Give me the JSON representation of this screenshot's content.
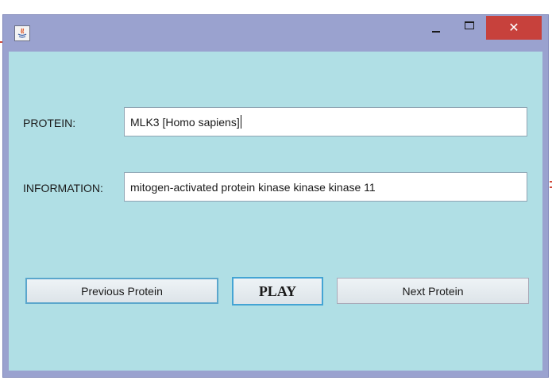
{
  "window": {
    "close_symbol": "✕",
    "icon": "java-app-icon"
  },
  "form": {
    "protein_label": "PROTEIN:",
    "protein_value": "MLK3 [Homo sapiens]",
    "information_label": "INFORMATION:",
    "information_value": "mitogen-activated protein kinase kinase kinase 11"
  },
  "buttons": {
    "previous_label": "Previous Protein",
    "play_label": "PLAY",
    "next_label": "Next Protein"
  },
  "colors": {
    "window_frame": "#9aa2cf",
    "content_background": "#b0dfe5",
    "close_button": "#c7413c",
    "focus_border": "#44a4d4"
  }
}
